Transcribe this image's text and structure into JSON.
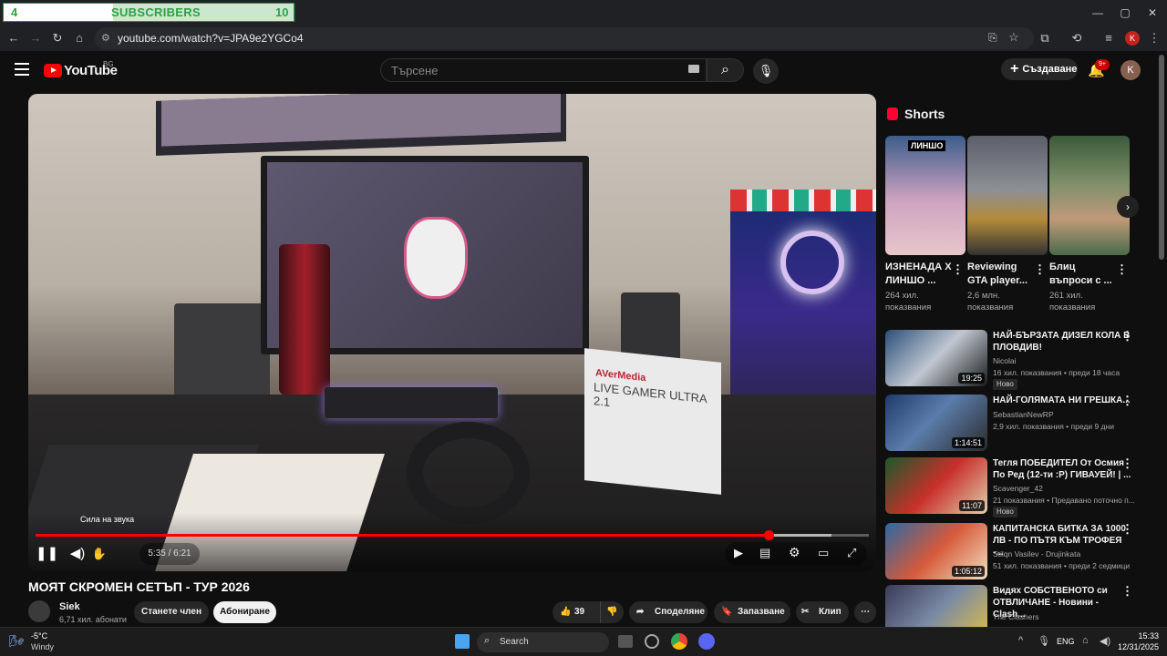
{
  "tab": {
    "count_left": "4",
    "title": "SUBSCRIBERS",
    "count_right": "10"
  },
  "window": {
    "minimize": "—",
    "maximize": "▢",
    "close": "✕"
  },
  "address": {
    "url": "youtube.com/watch?v=JPA9e2YGCo4"
  },
  "header": {
    "logo_text": "YouTube",
    "country_code": "BG",
    "search_placeholder": "Търсене",
    "create_label": "Създаване",
    "bell_badge": "9+",
    "avatar_letter": "K"
  },
  "player": {
    "tooltip": "Сила на звука",
    "time": "5:35 / 6:21",
    "progress": 0.88,
    "box_brand": "AVerMedia",
    "box_label": "LIVE GAMER ULTRA 2.1"
  },
  "video": {
    "title": "МОЯТ СКРОМЕН СЕТЪП - ТУР 2026",
    "channel": "Siek",
    "subs": "6,71 хил. абонати",
    "join": "Станете член",
    "subscribe": "Абониране",
    "likes": "39",
    "share": "Споделяне",
    "save": "Запазване",
    "clip": "Клип"
  },
  "shorts": {
    "heading": "Shorts",
    "items": [
      {
        "title": "ИЗНЕНАДА Х ЛИНШО ...",
        "views": "264 хил. показвания",
        "badge": "ЛИНШО"
      },
      {
        "title": "Reviewing GTA player...",
        "views": "2,6 млн. показвания"
      },
      {
        "title": "Блиц въпроси с ...",
        "views": "261 хил. показвания"
      }
    ]
  },
  "recommended": [
    {
      "title": "НАЙ-БЪРЗАТА ДИЗЕЛ КОЛА В ПЛОВДИВ!",
      "channel": "Nicolai",
      "meta": "16 хил. показвания • преди 18 часа",
      "duration": "19:25",
      "new": "Ново"
    },
    {
      "title": "НАЙ-ГОЛЯМАТА НИ ГРЕШКА...",
      "channel": "SebastianNewRP",
      "meta": "2,9 хил. показвания • преди 9 дни",
      "duration": "1:14:51"
    },
    {
      "title": "Тегля ПОБЕДИТЕЛ От Осмия По Ред (12-ти :P) ГИВАУЕЙ! | ...",
      "channel": "Scavenger_42",
      "meta": "21 показвания • Предавано поточно п...",
      "duration": "11:07",
      "new": "Ново"
    },
    {
      "title": "КАПИТАНСКА БИТКА ЗА 1000 ЛВ - ПО ПЪТЯ КЪМ ТРОФЕЯ -...",
      "channel": "Stilqn Vasilev - Drujinkata",
      "meta": "51 хил. показвания • преди 2 седмици",
      "duration": "1:05:12"
    },
    {
      "title": "Видях СОБСТВЕНОТО си ОТВЛИЧАНЕ - Новини - Clash...",
      "channel": "The Clashers"
    }
  ],
  "taskbar": {
    "weather_temp": "-5°C",
    "weather_desc": "Windy",
    "search": "Search",
    "lang": "ENG",
    "time": "15:33",
    "date": "12/31/2025"
  },
  "colors": {
    "accent": "#ff0000",
    "tab_green": "#2fa043"
  }
}
